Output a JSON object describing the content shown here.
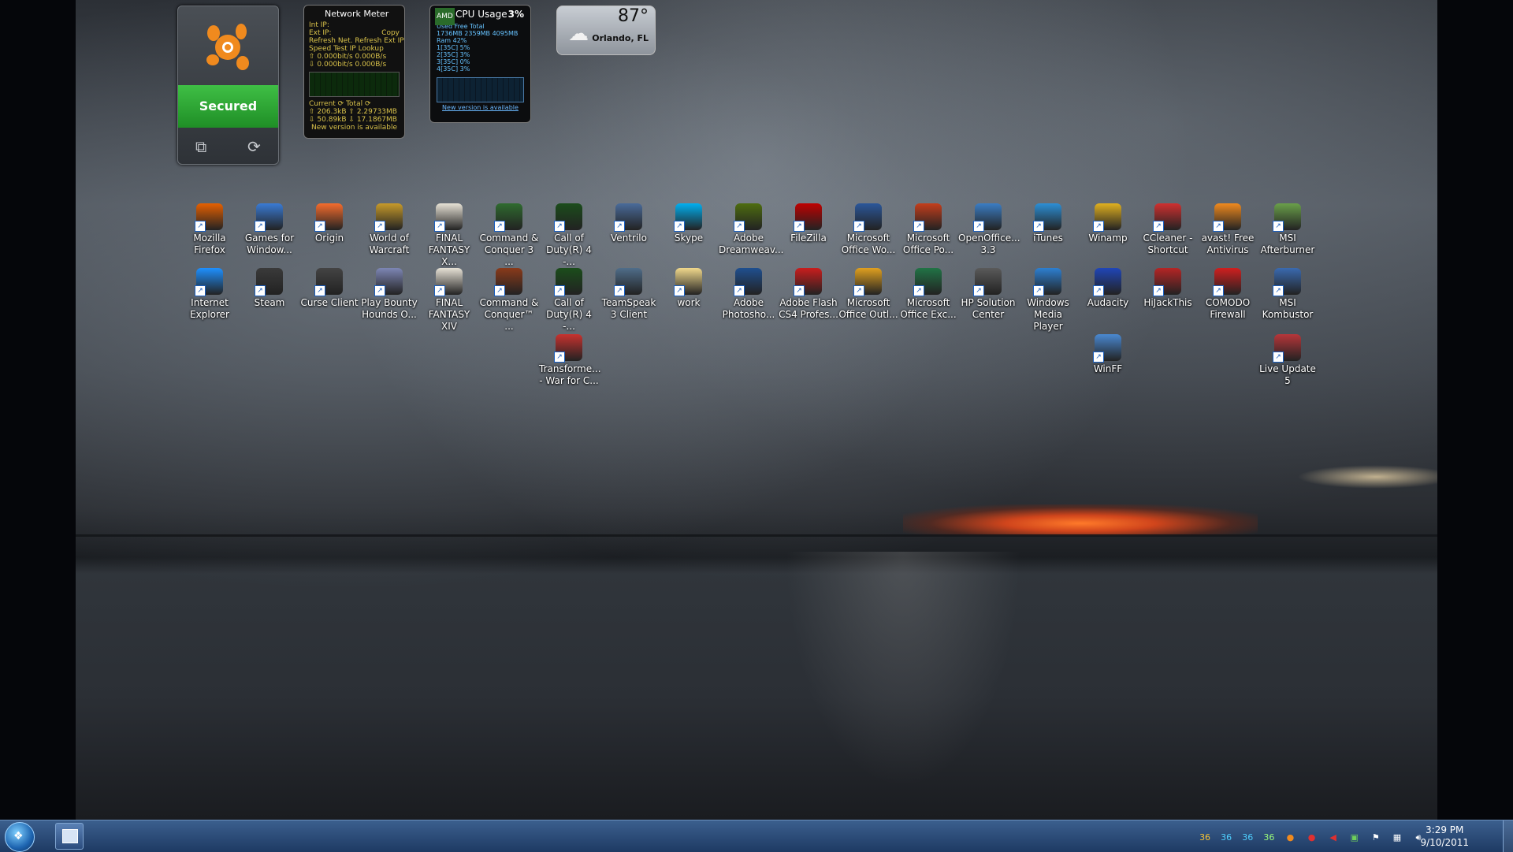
{
  "gadgets": {
    "avast": {
      "status": "Secured"
    },
    "network_meter": {
      "title": "Network Meter",
      "lines": [
        "Int IP:",
        "Ext IP:",
        "Refresh Net.   Refresh Ext IP",
        "Speed Test      IP Lookup",
        "⇧ 0.000bit/s     0.000B/s",
        "⇩ 0.000bit/s     0.000B/s"
      ],
      "footer_lines": [
        "Current ⟳      Total ⟳",
        "⇧ 206.3kB   ⇧ 2.29733MB",
        "⇩ 50.89kB   ⇩ 17.1867MB"
      ],
      "notice": "New version is available",
      "copy_label": "Copy"
    },
    "cpu_usage": {
      "title": "CPU Usage",
      "percent": "3%",
      "brand": "AMD",
      "headers": "Used      Free      Total",
      "memory": "1736MB   2359MB   4095MB",
      "ram": "Ram 42%",
      "cores": [
        "1[35C]   5%",
        "2[35C]   3%",
        "3[35C]   0%",
        "4[35C]   3%"
      ],
      "notice": "New version is available"
    },
    "weather": {
      "temperature": "87°",
      "city": "Orlando, FL"
    }
  },
  "desktop_icons": [
    {
      "label": "Mozilla Firefox",
      "icon": "firefox-icon",
      "color": "#e66000"
    },
    {
      "label": "Games for Window...",
      "icon": "windows-icon",
      "color": "#3a7bd5"
    },
    {
      "label": "Origin",
      "icon": "origin-icon",
      "color": "#f56c2d"
    },
    {
      "label": "World of Warcraft",
      "icon": "warcraft-icon",
      "color": "#c79a2a"
    },
    {
      "label": "FINAL FANTASY X...",
      "icon": "ffx-icon",
      "color": "#e7e2d6"
    },
    {
      "label": "Command & Conquer 3 ...",
      "icon": "cnc-icon",
      "color": "#2f6b2f"
    },
    {
      "label": "Call of Duty(R) 4 -...",
      "icon": "cod-icon",
      "color": "#1b4d1b"
    },
    {
      "label": "Ventrilo",
      "icon": "ventrilo-icon",
      "color": "#4a6b9a"
    },
    {
      "label": "Skype",
      "icon": "skype-icon",
      "color": "#00aff0"
    },
    {
      "label": "Adobe Dreamweav...",
      "icon": "dreamweaver-icon",
      "color": "#4e6d0f"
    },
    {
      "label": "FileZilla",
      "icon": "filezilla-icon",
      "color": "#bf0000"
    },
    {
      "label": "Microsoft Office Wo...",
      "icon": "word-icon",
      "color": "#2b579a"
    },
    {
      "label": "Microsoft Office Po...",
      "icon": "powerpoint-icon",
      "color": "#c43e1c"
    },
    {
      "label": "OpenOffice... 3.3",
      "icon": "openoffice-icon",
      "color": "#3b7dc4"
    },
    {
      "label": "iTunes",
      "icon": "itunes-icon",
      "color": "#2c8fd6"
    },
    {
      "label": "Winamp",
      "icon": "winamp-icon",
      "color": "#e0b020"
    },
    {
      "label": "CCleaner - Shortcut",
      "icon": "ccleaner-icon",
      "color": "#d03030"
    },
    {
      "label": "avast! Free Antivirus",
      "icon": "avast-icon",
      "color": "#f08a1e"
    },
    {
      "label": "MSI Afterburner",
      "icon": "afterburner-icon",
      "color": "#6aa04a"
    },
    {
      "label": "Internet Explorer",
      "icon": "ie-icon",
      "color": "#1e90ff"
    },
    {
      "label": "Steam",
      "icon": "steam-icon",
      "color": "#3a3a3a"
    },
    {
      "label": "Curse Client",
      "icon": "curse-icon",
      "color": "#444444"
    },
    {
      "label": "Play Bounty Hounds O...",
      "icon": "bounty-hounds-icon",
      "color": "#7d86b5"
    },
    {
      "label": "FINAL FANTASY XIV",
      "icon": "ffxiv-icon",
      "color": "#e7e2d6"
    },
    {
      "label": "Command & Conquer™ ...",
      "icon": "cnc-tiberium-icon",
      "color": "#8a3a1a"
    },
    {
      "label": "Call of Duty(R) 4 -...",
      "icon": "cod-mp-icon",
      "color": "#1b4d1b"
    },
    {
      "label": "TeamSpeak 3 Client",
      "icon": "teamspeak-icon",
      "color": "#4f6d8a"
    },
    {
      "label": "work",
      "icon": "folder-icon",
      "color": "#f1d98c"
    },
    {
      "label": "Adobe Photosho...",
      "icon": "photoshop-icon",
      "color": "#1f4f8f"
    },
    {
      "label": "Adobe Flash CS4 Profes...",
      "icon": "flash-icon",
      "color": "#c91d1d"
    },
    {
      "label": "Microsoft Office Outl...",
      "icon": "outlook-icon",
      "color": "#e0a020"
    },
    {
      "label": "Microsoft Office Exc...",
      "icon": "excel-icon",
      "color": "#217346"
    },
    {
      "label": "HP Solution Center",
      "icon": "hp-icon",
      "color": "#5a5a5a"
    },
    {
      "label": "Windows Media Player",
      "icon": "wmp-icon",
      "color": "#2d7fd1"
    },
    {
      "label": "Audacity",
      "icon": "audacity-icon",
      "color": "#2046b8"
    },
    {
      "label": "HiJackThis",
      "icon": "hijackthis-icon",
      "color": "#b52525"
    },
    {
      "label": "COMODO Firewall",
      "icon": "comodo-icon",
      "color": "#d01f1f"
    },
    {
      "label": "MSI Kombustor",
      "icon": "kombustor-icon",
      "color": "#3a6ab0"
    },
    {
      "label": "Transforme... - War for C...",
      "icon": "transformers-icon",
      "color": "#c8322f"
    },
    {
      "label": "WinFF",
      "icon": "winff-icon",
      "color": "#4a89d2"
    },
    {
      "label": "Live Update 5",
      "icon": "live-update-icon",
      "color": "#b8363a"
    }
  ],
  "taskbar": {
    "tray_labels": [
      "36",
      "36",
      "36",
      "36"
    ],
    "time": "3:29 PM",
    "date": "9/10/2011"
  }
}
